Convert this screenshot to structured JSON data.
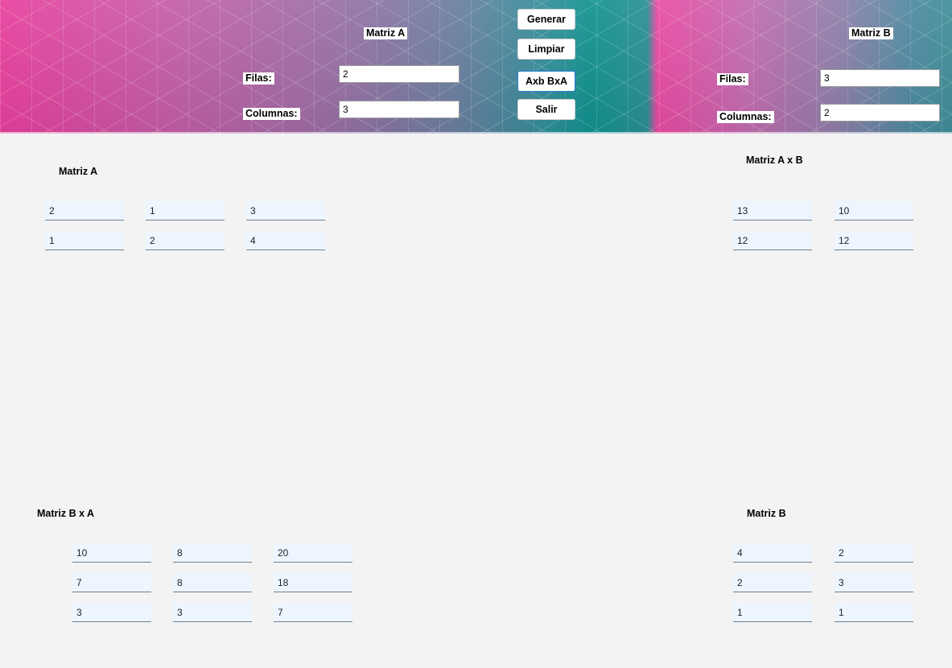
{
  "header": {
    "matrizA": {
      "title": "Matriz A",
      "filas_label": "Filas:",
      "filas_value": "2",
      "columnas_label": "Columnas:",
      "columnas_value": "3"
    },
    "matrizB": {
      "title": "Matriz B",
      "filas_label": "Filas:",
      "filas_value": "3",
      "columnas_label": "Columnas:",
      "columnas_value": "2"
    },
    "buttons": {
      "generar": "Generar",
      "limpiar": "Limpiar",
      "axb_bxa": "Axb BxA",
      "salir": "Salir"
    }
  },
  "matriz_a": {
    "title": "Matriz A",
    "rows": [
      [
        "2",
        "1",
        "3"
      ],
      [
        "1",
        "2",
        "4"
      ]
    ]
  },
  "matriz_axb": {
    "title": "Matriz A x B",
    "rows": [
      [
        "13",
        "10"
      ],
      [
        "12",
        "12"
      ]
    ]
  },
  "matriz_bxa": {
    "title": "Matriz B x A",
    "rows": [
      [
        "10",
        "8",
        "20"
      ],
      [
        "7",
        "8",
        "18"
      ],
      [
        "3",
        "3",
        "7"
      ]
    ]
  },
  "matriz_b": {
    "title": "Matriz B",
    "rows": [
      [
        "4",
        "2"
      ],
      [
        "2",
        "3"
      ],
      [
        "1",
        "1"
      ]
    ]
  },
  "colors": {
    "cell_background": "#edf6ff",
    "page_background": "#f3f3f3",
    "focus_border": "#2a7bd6"
  }
}
